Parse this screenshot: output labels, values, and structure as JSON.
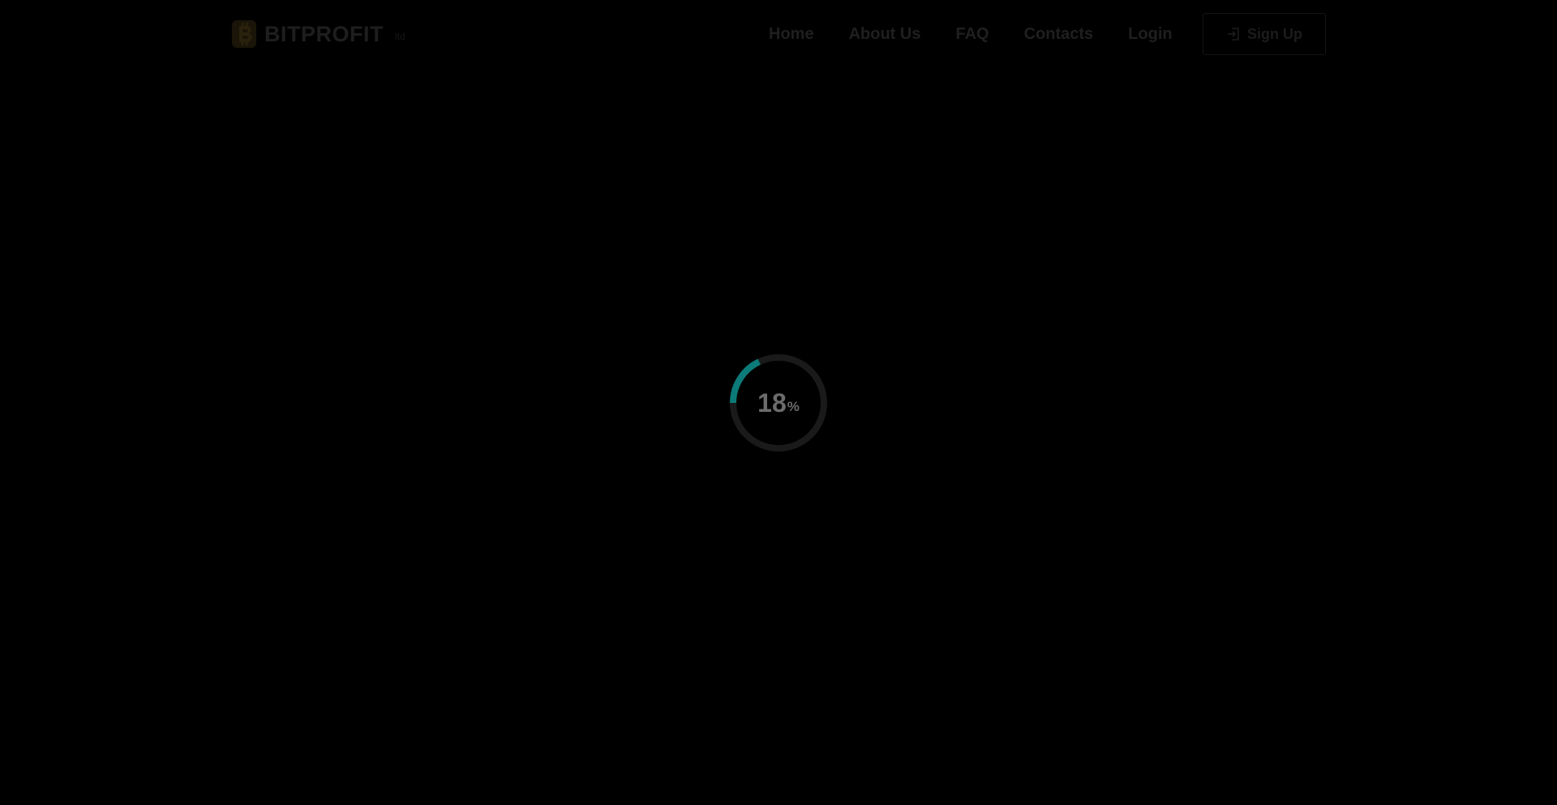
{
  "header": {
    "logo": {
      "text": "BITPROFIT",
      "tag": "ltd",
      "icon": "bitcoin-b-icon",
      "color": "#1e1e1e"
    },
    "nav": [
      {
        "label": "Home"
      },
      {
        "label": "About Us"
      },
      {
        "label": "FAQ"
      },
      {
        "label": "Contacts"
      },
      {
        "label": "Login"
      }
    ],
    "signup": {
      "label": "Sign Up",
      "icon": "sign-in-icon"
    }
  },
  "loader": {
    "value": "18",
    "unit": "%",
    "progress": 0.18,
    "track_color": "#1a1a1a",
    "progress_color": "#0b7a78"
  }
}
